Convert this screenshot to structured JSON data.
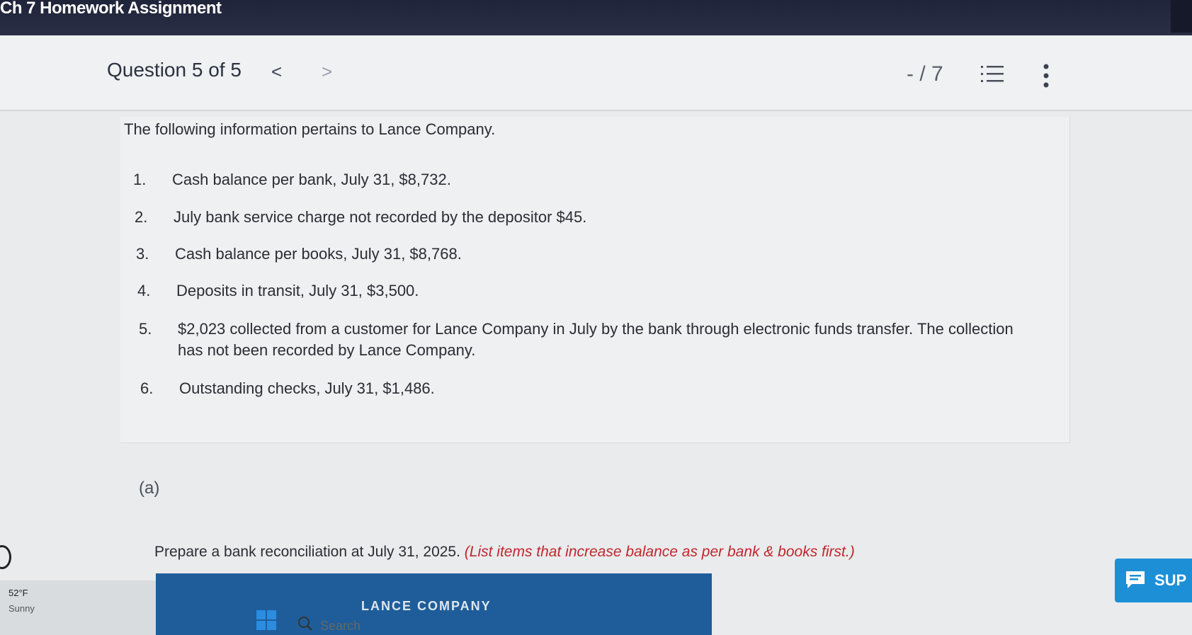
{
  "window": {
    "title": "Ch 7 Homework Assignment"
  },
  "header": {
    "question_label": "Question 5 of 5",
    "prev_glyph": "<",
    "next_glyph": ">",
    "score": "- / 7"
  },
  "problem": {
    "intro": "The following information pertains to Lance Company.",
    "items": [
      {
        "num": "1.",
        "text": "Cash balance per bank, July 31, $8,732."
      },
      {
        "num": "2.",
        "text": "July bank service charge not recorded by the depositor $45."
      },
      {
        "num": "3.",
        "text": "Cash balance per books, July 31, $8,768."
      },
      {
        "num": "4.",
        "text": "Deposits in transit, July 31, $3,500."
      },
      {
        "num": "5.",
        "text": "$2,023 collected from a customer for Lance Company in July by the bank through electronic funds transfer. The collection",
        "text2": "has not been recorded by Lance Company."
      },
      {
        "num": "6.",
        "text": "Outstanding checks, July 31, $1,486."
      }
    ]
  },
  "part": {
    "label": "(a)",
    "instruction": "Prepare a bank reconciliation at July 31, 2025.",
    "instruction_note": "(List items that increase balance as per bank & books first.)",
    "table_header": "LANCE COMPANY"
  },
  "support": {
    "label": "SUP"
  },
  "taskbar": {
    "temperature": "52°F",
    "condition": "Sunny",
    "search_label": "Search"
  },
  "colors": {
    "accent_blue": "#1f5d9a",
    "support_blue": "#1d8fd6",
    "note_red": "#c0272d"
  },
  "icons": [
    "chevron-left-icon",
    "chevron-right-icon",
    "list-icon",
    "kebab-menu-icon",
    "chat-icon",
    "windows-icon",
    "search-icon"
  ]
}
